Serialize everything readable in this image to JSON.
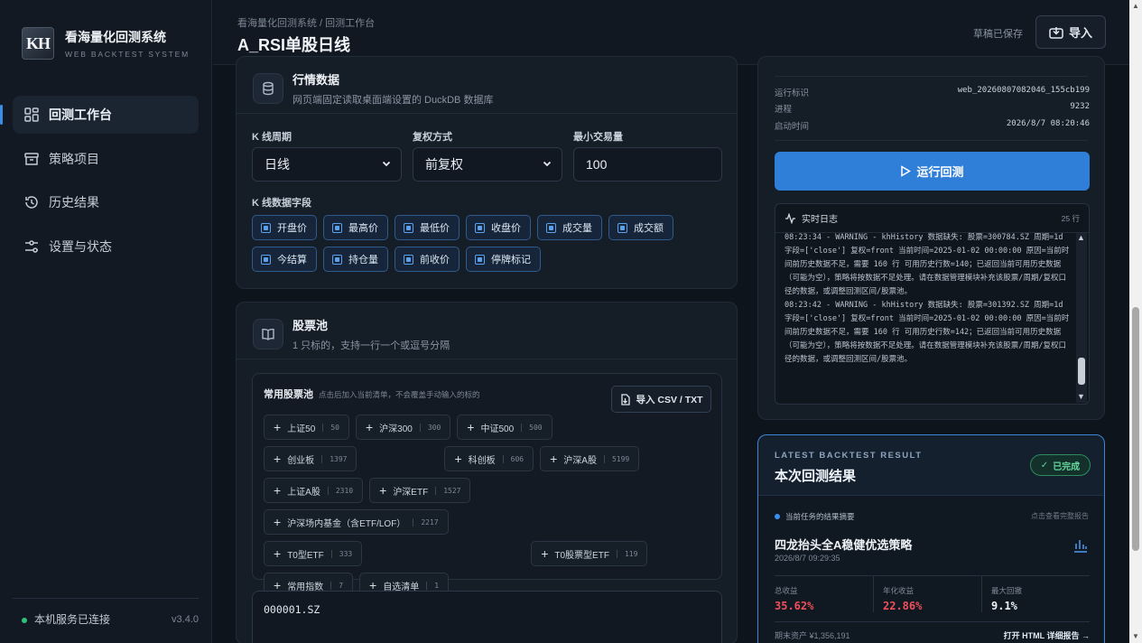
{
  "sidebar": {
    "logo_mark": "KH",
    "logo_title": "看海量化回测系统",
    "logo_sub": "WEB BACKTEST SYSTEM",
    "items": [
      {
        "label": "回测工作台",
        "icon": "dashboard-icon"
      },
      {
        "label": "策略项目",
        "icon": "archive-icon"
      },
      {
        "label": "历史结果",
        "icon": "history-icon"
      },
      {
        "label": "设置与状态",
        "icon": "sliders-icon"
      }
    ],
    "status": "本机服务已连接",
    "version": "v3.4.0"
  },
  "header": {
    "breadcrumb": "看海量化回测系统 / 回测工作台",
    "title": "A_RSI单股日线",
    "draft_status": "草稿已保存",
    "import_label": "导入"
  },
  "market": {
    "title": "行情数据",
    "subtitle": "网页端固定读取桌面端设置的 DuckDB 数据库",
    "period_label": "K 线周期",
    "period_value": "日线",
    "adjust_label": "复权方式",
    "adjust_value": "前复权",
    "min_vol_label": "最小交易量",
    "min_vol_value": "100",
    "fields_label": "K 线数据字段",
    "fields": [
      "开盘价",
      "最高价",
      "最低价",
      "收盘价",
      "成交量",
      "成交额",
      "今结算",
      "持仓量",
      "前收价",
      "停牌标记"
    ]
  },
  "pool": {
    "title": "股票池",
    "subtitle": "1 只标的，支持一行一个或逗号分隔",
    "common_title": "常用股票池",
    "common_hint": "点击后加入当前清单，不会覆盖手动输入的标的",
    "csv_label": "导入 CSV / TXT",
    "chips": [
      {
        "name": "上证50",
        "count": "50"
      },
      {
        "name": "沪深300",
        "count": "300"
      },
      {
        "name": "中证500",
        "count": "500"
      },
      {
        "name": "创业板",
        "count": "1397"
      },
      {
        "name": "科创板",
        "count": "606"
      },
      {
        "name": "沪深A股",
        "count": "5199"
      },
      {
        "name": "上证A股",
        "count": "2310"
      },
      {
        "name": "沪深ETF",
        "count": "1527"
      },
      {
        "name": "沪深场内基金（含ETF/LOF）",
        "count": "2217"
      },
      {
        "name": "T0型ETF",
        "count": "333"
      },
      {
        "name": "T0股票型ETF",
        "count": "119"
      },
      {
        "name": "常用指数",
        "count": "7"
      },
      {
        "name": "自选清单",
        "count": "1"
      }
    ],
    "codes": "000001.SZ"
  },
  "run": {
    "meta": [
      {
        "k": "运行标识",
        "v": "web_20260807082046_155cb199"
      },
      {
        "k": "进程",
        "v": "9232"
      },
      {
        "k": "启动时间",
        "v": "2026/8/7 08:20:46"
      }
    ],
    "run_label": "运行回测",
    "log_title": "实时日志",
    "log_count": "25 行",
    "log_text": "08:23:34 - WARNING - khHistory 数据缺失: 股票=300784.SZ 周期=1d 字段=['close'] 复权=front 当前时间=2025-01-02 00:00:00 原因=当前时间前历史数据不足，需要 160 行 可用历史行数=140；已返回当前可用历史数据（可能为空），策略将按数据不足处理。请在数据管理模块补充该股票/周期/复权口径的数据，或调整回测区间/股票池。\n08:23:42 - WARNING - khHistory 数据缺失: 股票=301392.SZ 周期=1d 字段=['close'] 复权=front 当前时间=2025-01-02 00:00:00 原因=当前时间前历史数据不足，需要 160 行 可用历史行数=142；已返回当前可用历史数据（可能为空），策略将按数据不足处理。请在数据管理模块补充该股票/周期/复权口径的数据，或调整回测区间/股票池。"
  },
  "result": {
    "tag": "LATEST BACKTEST RESULT",
    "title": "本次回测结果",
    "badge": "已完成",
    "note": "当前任务的结果摘要",
    "view_full": "点击查看完整报告",
    "strategy": "四龙抬头全A稳健优选策略",
    "time": "2026/8/7 09:29:35",
    "stats": [
      {
        "k": "总收益",
        "v": "35.62%"
      },
      {
        "k": "年化收益",
        "v": "22.86%"
      },
      {
        "k": "最大回撤",
        "v": "9.1%"
      }
    ],
    "final_asset": "期末资产 ¥1,356,191",
    "open_report": "打开 HTML 详细报告 →"
  },
  "colors": {
    "accent": "#2f7fd9",
    "positive": "#f0505a",
    "success": "#2fc27a"
  }
}
